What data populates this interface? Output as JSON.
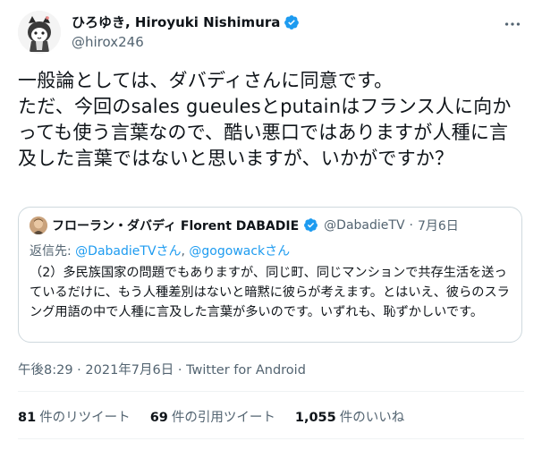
{
  "author": {
    "name": "ひろゆき, Hiroyuki Nishimura",
    "handle": "@hirox246",
    "verified": true
  },
  "tweet": {
    "text": "一般論としては、ダバディさんに同意です。\nただ、今回のsales gueulesとputainはフランス人に向かっても使う言葉なので、酷い悪口ではありますが人種に言及した言葉ではないと思いますが、いかがですか？"
  },
  "quote": {
    "name": "フローラン・ダバディ Florent DABADIE",
    "handle": "@DabadieTV",
    "date": "7月6日",
    "separator": "·",
    "reply_prefix": "返信先: ",
    "reply_to_1": "@DabadieTVさん",
    "reply_sep": ", ",
    "reply_to_2": "@gogowackさん",
    "text": "（2）多民族国家の問題でもありますが、同じ町、同じマンションで共存生活を送っているだけに、もう人種差別はないと暗黙に彼らが考えます。とはいえ、彼らのスラング用語の中で人種に言及した言葉が多いのです。いずれも、恥ずかしいです。"
  },
  "timestamp": {
    "time_date": "午後8:29 · 2021年7月6日",
    "separator": " · ",
    "source": "Twitter for Android"
  },
  "stats": {
    "retweets_count": "81",
    "retweets_label": "件のリツイート",
    "quotes_count": "69",
    "quotes_label": "件の引用ツイート",
    "likes_count": "1,055",
    "likes_label": "件のいいね"
  },
  "colors": {
    "accent": "#1d9bf0",
    "secondary_text": "#536471",
    "border": "#cfd9de"
  }
}
